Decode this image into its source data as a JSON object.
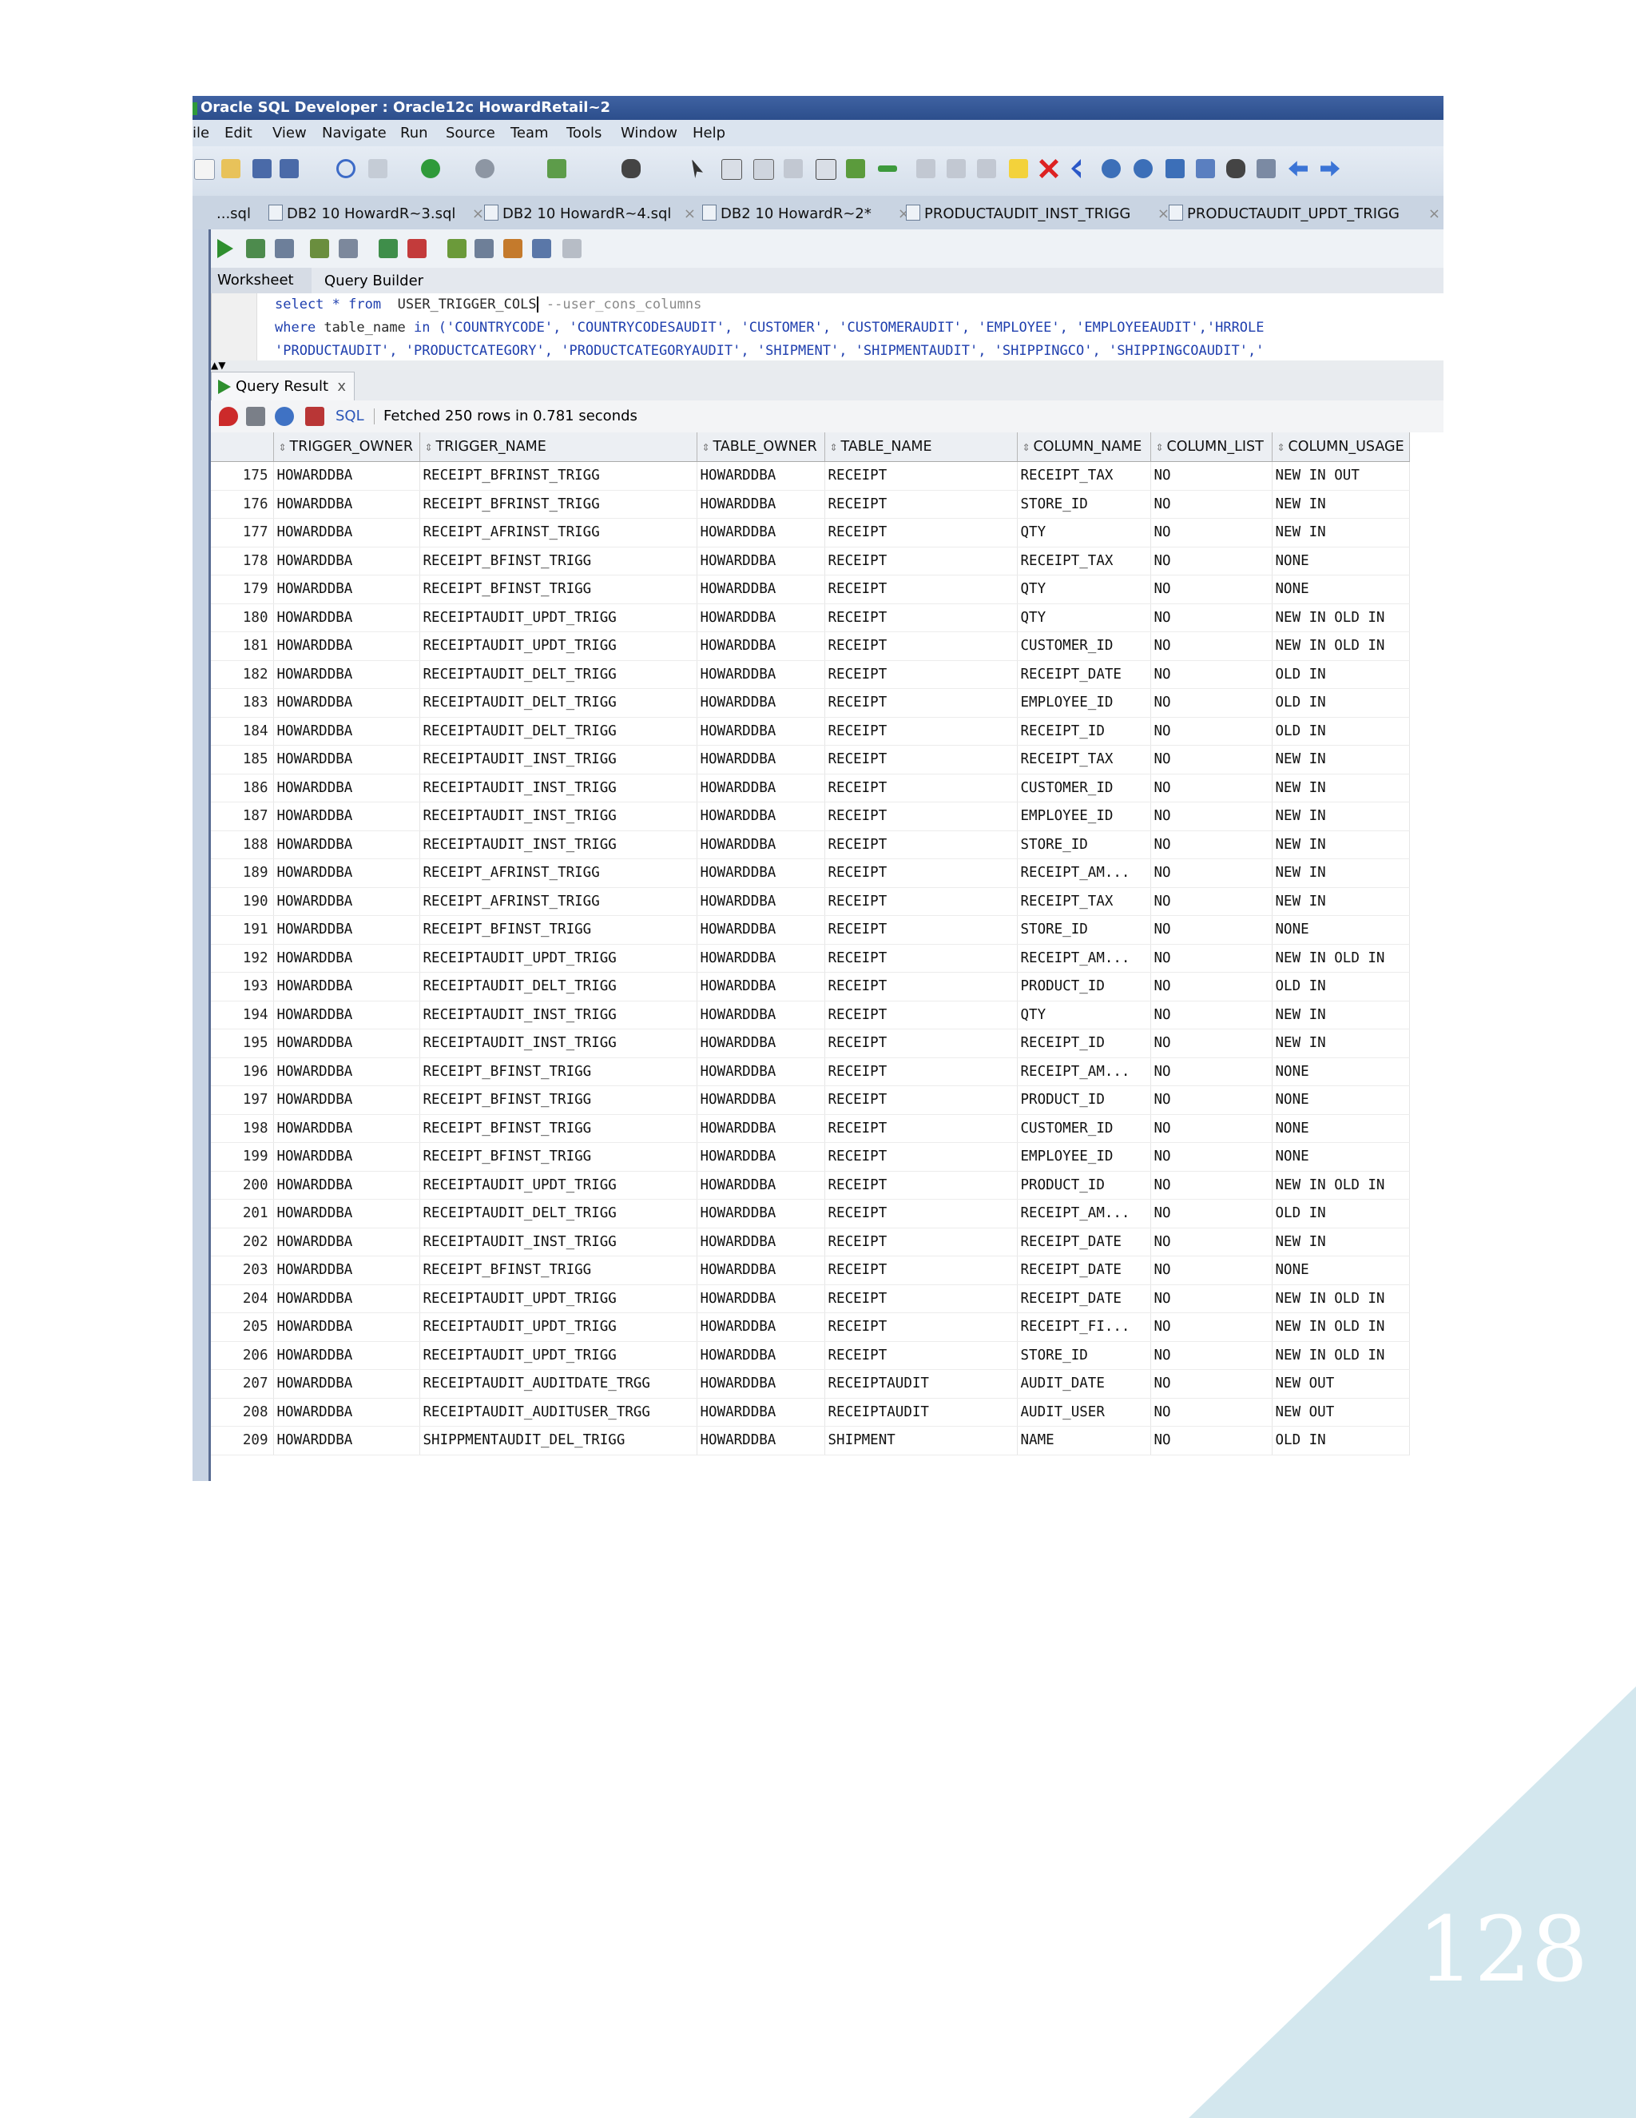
{
  "window": {
    "title": "Oracle SQL Developer : Oracle12c HowardRetail~2"
  },
  "menu": [
    "ile",
    "Edit",
    "View",
    "Navigate",
    "Run",
    "Source",
    "Team",
    "Tools",
    "Window",
    "Help"
  ],
  "editor_tabs": [
    {
      "label": "...sql"
    },
    {
      "label": "DB2 10 HowardR~3.sql"
    },
    {
      "label": "DB2 10 HowardR~4.sql"
    },
    {
      "label": "DB2 10 HowardR~2*"
    },
    {
      "label": "PRODUCTAUDIT_INST_TRIGG"
    },
    {
      "label": "PRODUCTAUDIT_UPDT_TRIGG"
    }
  ],
  "worksheet_tabs": {
    "worksheet": "Worksheet",
    "query_builder": "Query Builder"
  },
  "sql": {
    "line1_kw1": "select",
    "line1_star": "*",
    "line1_kw2": "from",
    "line1_table": "USER_TRIGGER_COLS",
    "line1_comment": "--user_cons_columns",
    "line2_kw": "where",
    "line2_text": "table_name",
    "line2_in": "in",
    "line2_values": "('COUNTRYCODE', 'COUNTRYCODESAUDIT', 'CUSTOMER', 'CUSTOMERAUDIT', 'EMPLOYEE', 'EMPLOYEEAUDIT','HRROLE",
    "line3_values": "'PRODUCTAUDIT', 'PRODUCTCATEGORY', 'PRODUCTCATEGORYAUDIT', 'SHIPMENT', 'SHIPMENTAUDIT', 'SHIPPINGCO', 'SHIPPINGCOAUDIT','"
  },
  "result": {
    "tab_label": "Query Result",
    "tab_close": "x",
    "sql_label": "SQL",
    "status": "Fetched 250 rows in 0.781 seconds"
  },
  "columns": [
    "TRIGGER_OWNER",
    "TRIGGER_NAME",
    "TABLE_OWNER",
    "TABLE_NAME",
    "COLUMN_NAME",
    "COLUMN_LIST",
    "COLUMN_USAGE"
  ],
  "rows": [
    [
      "175",
      "HOWARDDBA",
      "RECEIPT_BFRINST_TRIGG",
      "HOWARDDBA",
      "RECEIPT",
      "RECEIPT_TAX",
      "NO",
      "NEW IN OUT"
    ],
    [
      "176",
      "HOWARDDBA",
      "RECEIPT_BFRINST_TRIGG",
      "HOWARDDBA",
      "RECEIPT",
      "STORE_ID",
      "NO",
      "NEW IN"
    ],
    [
      "177",
      "HOWARDDBA",
      "RECEIPT_AFRINST_TRIGG",
      "HOWARDDBA",
      "RECEIPT",
      "QTY",
      "NO",
      "NEW IN"
    ],
    [
      "178",
      "HOWARDDBA",
      "RECEIPT_BFINST_TRIGG",
      "HOWARDDBA",
      "RECEIPT",
      "RECEIPT_TAX",
      "NO",
      "NONE"
    ],
    [
      "179",
      "HOWARDDBA",
      "RECEIPT_BFINST_TRIGG",
      "HOWARDDBA",
      "RECEIPT",
      "QTY",
      "NO",
      "NONE"
    ],
    [
      "180",
      "HOWARDDBA",
      "RECEIPTAUDIT_UPDT_TRIGG",
      "HOWARDDBA",
      "RECEIPT",
      "QTY",
      "NO",
      "NEW IN OLD IN"
    ],
    [
      "181",
      "HOWARDDBA",
      "RECEIPTAUDIT_UPDT_TRIGG",
      "HOWARDDBA",
      "RECEIPT",
      "CUSTOMER_ID",
      "NO",
      "NEW IN OLD IN"
    ],
    [
      "182",
      "HOWARDDBA",
      "RECEIPTAUDIT_DELT_TRIGG",
      "HOWARDDBA",
      "RECEIPT",
      "RECEIPT_DATE",
      "NO",
      "OLD IN"
    ],
    [
      "183",
      "HOWARDDBA",
      "RECEIPTAUDIT_DELT_TRIGG",
      "HOWARDDBA",
      "RECEIPT",
      "EMPLOYEE_ID",
      "NO",
      "OLD IN"
    ],
    [
      "184",
      "HOWARDDBA",
      "RECEIPTAUDIT_DELT_TRIGG",
      "HOWARDDBA",
      "RECEIPT",
      "RECEIPT_ID",
      "NO",
      "OLD IN"
    ],
    [
      "185",
      "HOWARDDBA",
      "RECEIPTAUDIT_INST_TRIGG",
      "HOWARDDBA",
      "RECEIPT",
      "RECEIPT_TAX",
      "NO",
      "NEW IN"
    ],
    [
      "186",
      "HOWARDDBA",
      "RECEIPTAUDIT_INST_TRIGG",
      "HOWARDDBA",
      "RECEIPT",
      "CUSTOMER_ID",
      "NO",
      "NEW IN"
    ],
    [
      "187",
      "HOWARDDBA",
      "RECEIPTAUDIT_INST_TRIGG",
      "HOWARDDBA",
      "RECEIPT",
      "EMPLOYEE_ID",
      "NO",
      "NEW IN"
    ],
    [
      "188",
      "HOWARDDBA",
      "RECEIPTAUDIT_INST_TRIGG",
      "HOWARDDBA",
      "RECEIPT",
      "STORE_ID",
      "NO",
      "NEW IN"
    ],
    [
      "189",
      "HOWARDDBA",
      "RECEIPT_AFRINST_TRIGG",
      "HOWARDDBA",
      "RECEIPT",
      "RECEIPT_AM...",
      "NO",
      "NEW IN"
    ],
    [
      "190",
      "HOWARDDBA",
      "RECEIPT_AFRINST_TRIGG",
      "HOWARDDBA",
      "RECEIPT",
      "RECEIPT_TAX",
      "NO",
      "NEW IN"
    ],
    [
      "191",
      "HOWARDDBA",
      "RECEIPT_BFINST_TRIGG",
      "HOWARDDBA",
      "RECEIPT",
      "STORE_ID",
      "NO",
      "NONE"
    ],
    [
      "192",
      "HOWARDDBA",
      "RECEIPTAUDIT_UPDT_TRIGG",
      "HOWARDDBA",
      "RECEIPT",
      "RECEIPT_AM...",
      "NO",
      "NEW IN OLD IN"
    ],
    [
      "193",
      "HOWARDDBA",
      "RECEIPTAUDIT_DELT_TRIGG",
      "HOWARDDBA",
      "RECEIPT",
      "PRODUCT_ID",
      "NO",
      "OLD IN"
    ],
    [
      "194",
      "HOWARDDBA",
      "RECEIPTAUDIT_INST_TRIGG",
      "HOWARDDBA",
      "RECEIPT",
      "QTY",
      "NO",
      "NEW IN"
    ],
    [
      "195",
      "HOWARDDBA",
      "RECEIPTAUDIT_INST_TRIGG",
      "HOWARDDBA",
      "RECEIPT",
      "RECEIPT_ID",
      "NO",
      "NEW IN"
    ],
    [
      "196",
      "HOWARDDBA",
      "RECEIPT_BFINST_TRIGG",
      "HOWARDDBA",
      "RECEIPT",
      "RECEIPT_AM...",
      "NO",
      "NONE"
    ],
    [
      "197",
      "HOWARDDBA",
      "RECEIPT_BFINST_TRIGG",
      "HOWARDDBA",
      "RECEIPT",
      "PRODUCT_ID",
      "NO",
      "NONE"
    ],
    [
      "198",
      "HOWARDDBA",
      "RECEIPT_BFINST_TRIGG",
      "HOWARDDBA",
      "RECEIPT",
      "CUSTOMER_ID",
      "NO",
      "NONE"
    ],
    [
      "199",
      "HOWARDDBA",
      "RECEIPT_BFINST_TRIGG",
      "HOWARDDBA",
      "RECEIPT",
      "EMPLOYEE_ID",
      "NO",
      "NONE"
    ],
    [
      "200",
      "HOWARDDBA",
      "RECEIPTAUDIT_UPDT_TRIGG",
      "HOWARDDBA",
      "RECEIPT",
      "PRODUCT_ID",
      "NO",
      "NEW IN OLD IN"
    ],
    [
      "201",
      "HOWARDDBA",
      "RECEIPTAUDIT_DELT_TRIGG",
      "HOWARDDBA",
      "RECEIPT",
      "RECEIPT_AM...",
      "NO",
      "OLD IN"
    ],
    [
      "202",
      "HOWARDDBA",
      "RECEIPTAUDIT_INST_TRIGG",
      "HOWARDDBA",
      "RECEIPT",
      "RECEIPT_DATE",
      "NO",
      "NEW IN"
    ],
    [
      "203",
      "HOWARDDBA",
      "RECEIPT_BFINST_TRIGG",
      "HOWARDDBA",
      "RECEIPT",
      "RECEIPT_DATE",
      "NO",
      "NONE"
    ],
    [
      "204",
      "HOWARDDBA",
      "RECEIPTAUDIT_UPDT_TRIGG",
      "HOWARDDBA",
      "RECEIPT",
      "RECEIPT_DATE",
      "NO",
      "NEW IN OLD IN"
    ],
    [
      "205",
      "HOWARDDBA",
      "RECEIPTAUDIT_UPDT_TRIGG",
      "HOWARDDBA",
      "RECEIPT",
      "RECEIPT_FI...",
      "NO",
      "NEW IN OLD IN"
    ],
    [
      "206",
      "HOWARDDBA",
      "RECEIPTAUDIT_UPDT_TRIGG",
      "HOWARDDBA",
      "RECEIPT",
      "STORE_ID",
      "NO",
      "NEW IN OLD IN"
    ],
    [
      "207",
      "HOWARDDBA",
      "RECEIPTAUDIT_AUDITDATE_TRGG",
      "HOWARDDBA",
      "RECEIPTAUDIT",
      "AUDIT_DATE",
      "NO",
      "NEW OUT"
    ],
    [
      "208",
      "HOWARDDBA",
      "RECEIPTAUDIT_AUDITUSER_TRGG",
      "HOWARDDBA",
      "RECEIPTAUDIT",
      "AUDIT_USER",
      "NO",
      "NEW OUT"
    ],
    [
      "209",
      "HOWARDDBA",
      "SHIPPMENTAUDIT_DEL_TRIGG",
      "HOWARDDBA",
      "SHIPMENT",
      "NAME",
      "NO",
      "OLD IN"
    ]
  ],
  "page_number": "128",
  "colors": {
    "titlebar": "#2c4e8c",
    "corner_triangle": "#d3e7ee",
    "sql_keyword": "#1f3fae"
  }
}
